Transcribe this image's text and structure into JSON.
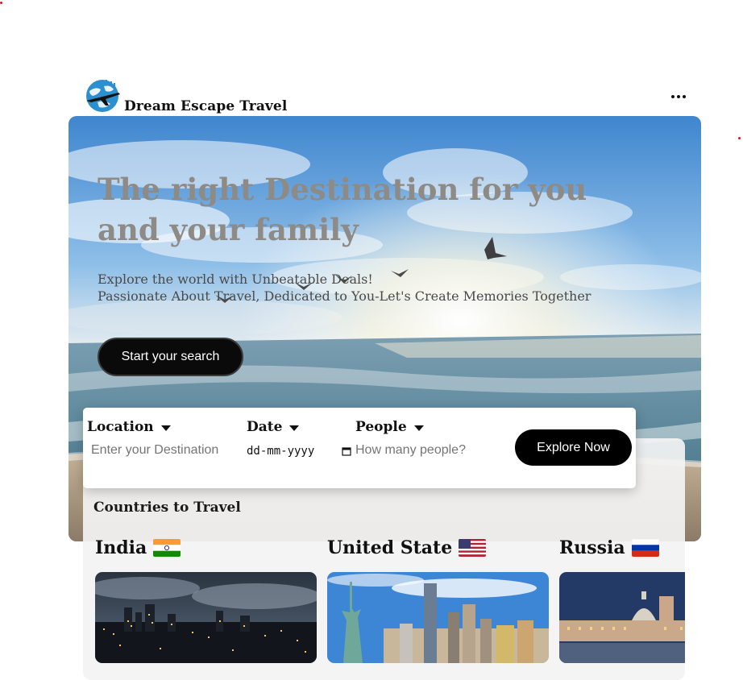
{
  "header": {
    "brand": "Dream Escape Travel",
    "logo_icon": "globe-airplane-icon",
    "menu_icon": "more-dots-icon"
  },
  "hero": {
    "title": "The right Destination for you and your family",
    "subtitle_line1": "Explore the world with Unbeatable Deals!",
    "subtitle_line2": "Passionate About Travel, Dedicated to You-Let's Create Memories Together",
    "cta_label": "Start your search"
  },
  "search": {
    "location_label": "Location",
    "location_placeholder": "Enter your Destination",
    "date_label": "Date",
    "date_value": "dd-mm-yyyy",
    "people_label": "People",
    "people_placeholder": "How many people?",
    "explore_label": "Explore Now"
  },
  "countries": {
    "title": "Countries to Travel",
    "items": [
      {
        "name": "India",
        "flag_icon": "india-flag-icon"
      },
      {
        "name": "United State",
        "flag_icon": "usa-flag-icon"
      },
      {
        "name": "Russia",
        "flag_icon": "russia-flag-icon"
      }
    ]
  },
  "colors": {
    "accent": "#000000",
    "title_gray": "#8e8a86",
    "sky_blue": "#4a8fd6"
  }
}
